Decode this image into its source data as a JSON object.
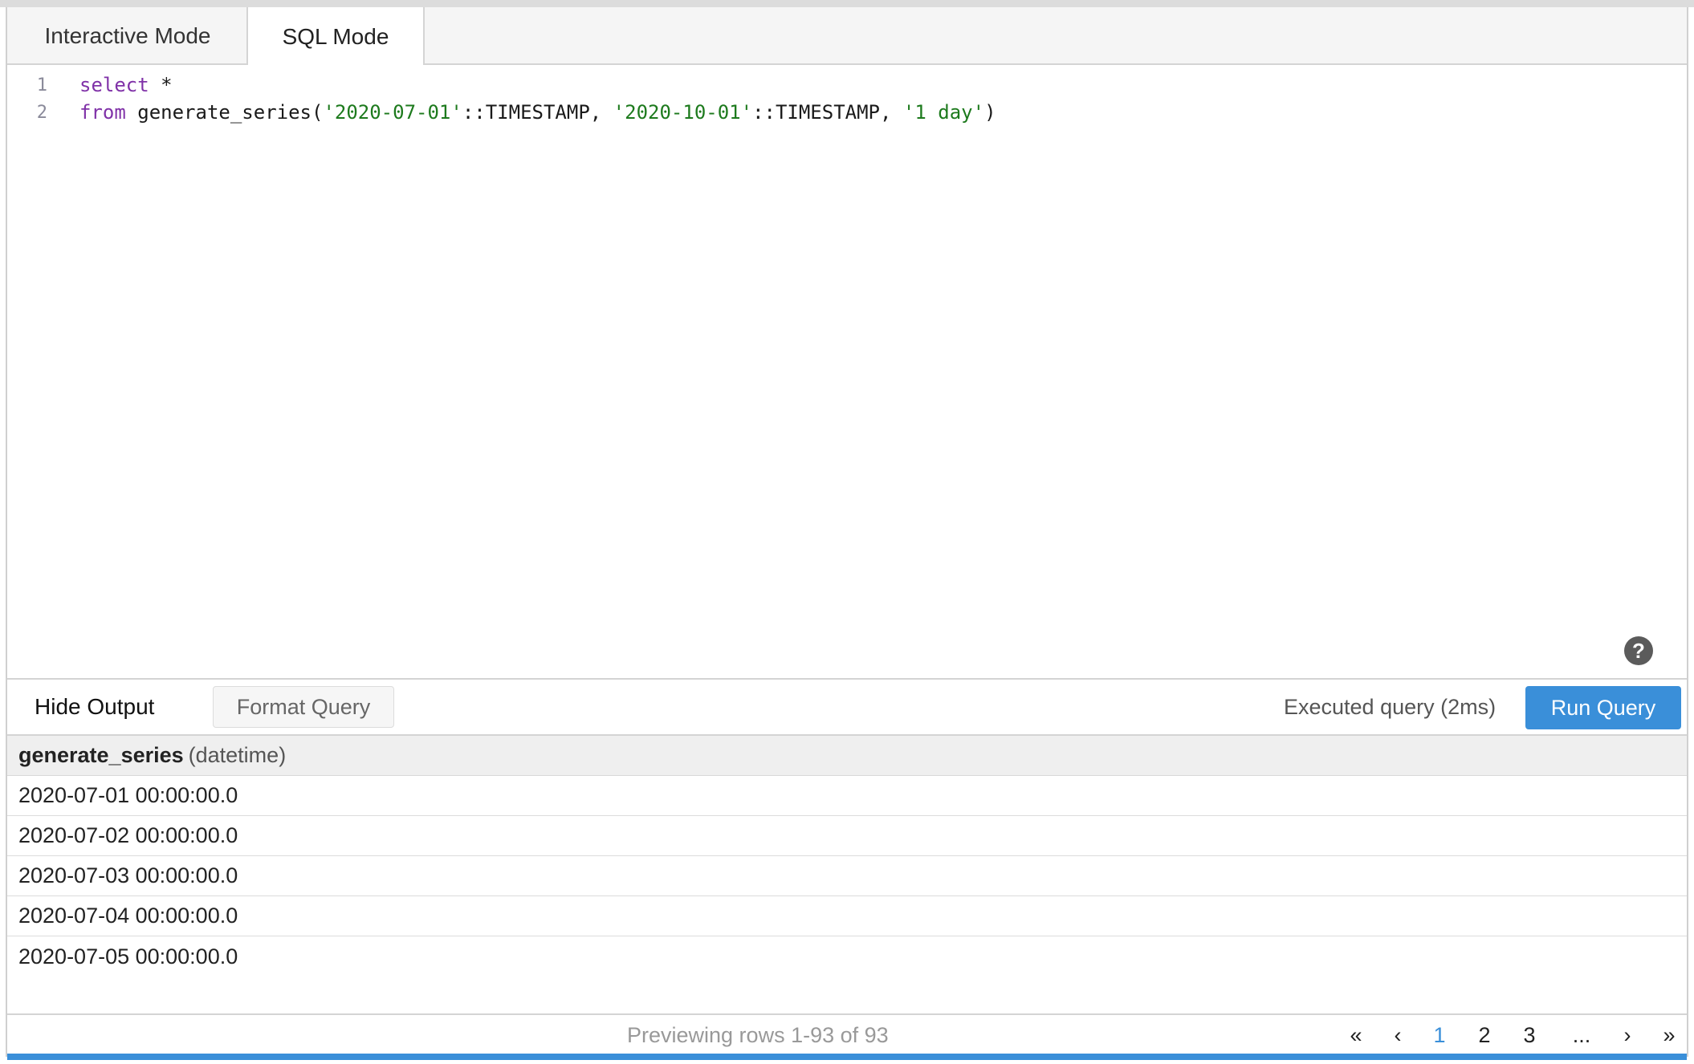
{
  "tabs": {
    "interactive": "Interactive Mode",
    "sql": "SQL Mode"
  },
  "editor": {
    "lines": [
      {
        "number": "1",
        "tokens": [
          {
            "text": "select",
            "kind": "kw"
          },
          {
            "text": " *",
            "kind": "plain"
          }
        ]
      },
      {
        "number": "2",
        "tokens": [
          {
            "text": "from",
            "kind": "kw"
          },
          {
            "text": " generate_series(",
            "kind": "plain"
          },
          {
            "text": "'2020-07-01'",
            "kind": "str"
          },
          {
            "text": "::TIMESTAMP, ",
            "kind": "plain"
          },
          {
            "text": "'2020-10-01'",
            "kind": "str"
          },
          {
            "text": "::TIMESTAMP, ",
            "kind": "plain"
          },
          {
            "text": "'1 day'",
            "kind": "str"
          },
          {
            "text": ")",
            "kind": "plain"
          }
        ]
      }
    ],
    "help_symbol": "?"
  },
  "toolbar": {
    "hide_output": "Hide Output",
    "format_query": "Format Query",
    "status": "Executed query (2ms)",
    "run_query": "Run Query"
  },
  "results": {
    "column_name": "generate_series",
    "column_type": "(datetime)",
    "rows": [
      "2020-07-01 00:00:00.0",
      "2020-07-02 00:00:00.0",
      "2020-07-03 00:00:00.0",
      "2020-07-04 00:00:00.0",
      "2020-07-05 00:00:00.0"
    ]
  },
  "footer": {
    "preview": "Previewing rows 1-93 of 93",
    "pager": {
      "first": "«",
      "prev": "‹",
      "pages": [
        "1",
        "2",
        "3"
      ],
      "ellipsis": "...",
      "next": "›",
      "last": "»",
      "active": "1"
    }
  },
  "colors": {
    "accent": "#3a8fd9",
    "keyword": "#8032a8",
    "string": "#1d7a1d"
  }
}
